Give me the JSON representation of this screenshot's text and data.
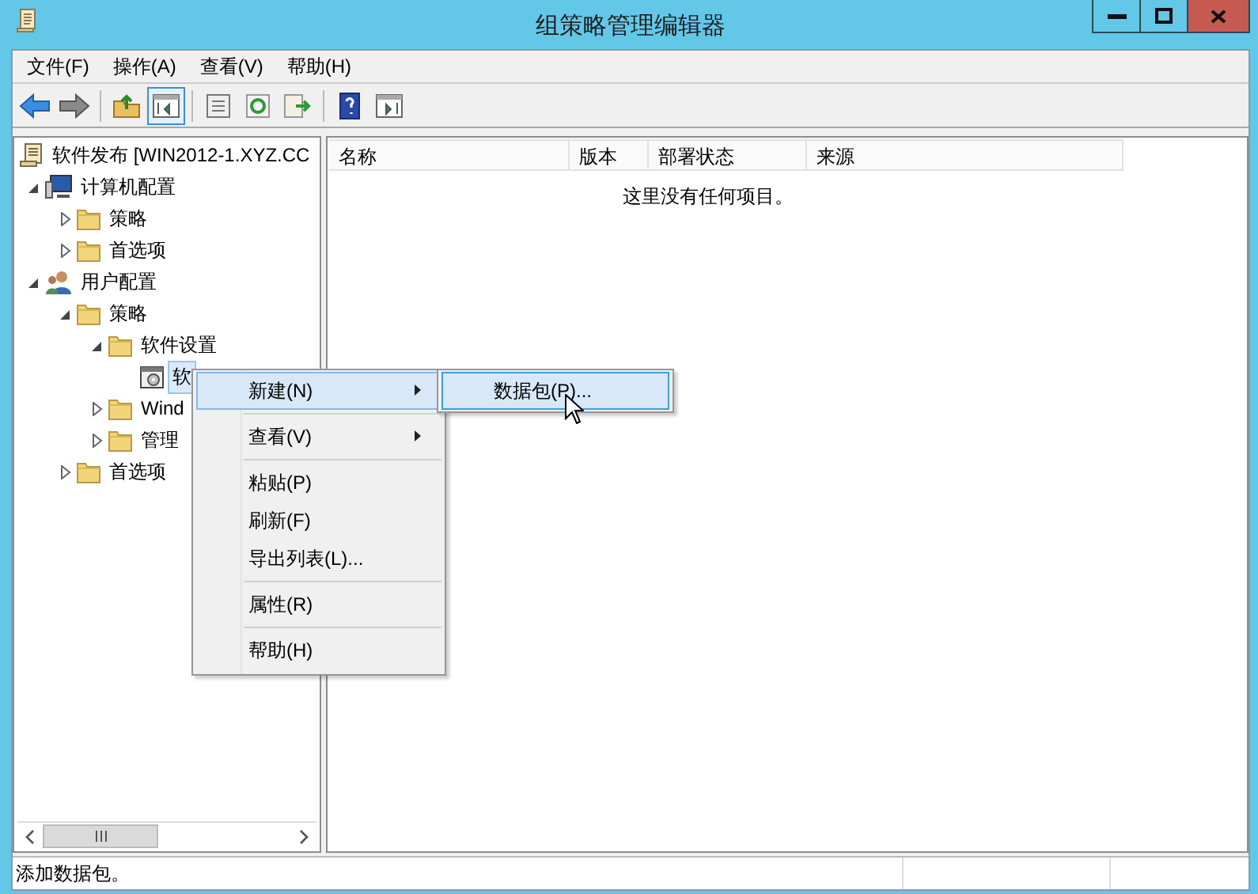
{
  "window": {
    "title": "组策略管理编辑器"
  },
  "menu_bar": [
    {
      "label": "文件(F)"
    },
    {
      "label": "操作(A)"
    },
    {
      "label": "查看(V)"
    },
    {
      "label": "帮助(H)"
    }
  ],
  "toolbar": [
    {
      "kind": "back",
      "selected": false
    },
    {
      "kind": "forward",
      "selected": false
    },
    {
      "kind": "sep"
    },
    {
      "kind": "up",
      "selected": false
    },
    {
      "kind": "console-tree",
      "selected": true
    },
    {
      "kind": "sep"
    },
    {
      "kind": "properties",
      "selected": false
    },
    {
      "kind": "refresh",
      "selected": false
    },
    {
      "kind": "export",
      "selected": false
    },
    {
      "kind": "sep"
    },
    {
      "kind": "help",
      "selected": false
    },
    {
      "kind": "action-pane",
      "selected": false
    }
  ],
  "tree": [
    {
      "label": "软件发布 [WIN2012-1.XYZ.CC",
      "kind": "gpo",
      "selected": false,
      "children": [
        {
          "label": "计算机配置",
          "kind": "computer",
          "expanded": true,
          "selected": false,
          "children": [
            {
              "label": "策略",
              "kind": "folder",
              "expanded": false,
              "selected": false
            },
            {
              "label": "首选项",
              "kind": "folder",
              "expanded": false,
              "selected": false
            }
          ]
        },
        {
          "label": "用户配置",
          "kind": "user",
          "expanded": true,
          "selected": false,
          "children": [
            {
              "label": "策略",
              "kind": "folder",
              "expanded": true,
              "selected": false,
              "children": [
                {
                  "label": "软件设置",
                  "kind": "folder",
                  "expanded": true,
                  "selected": false,
                  "children": [
                    {
                      "label": "软",
                      "kind": "package",
                      "selected": true
                    }
                  ]
                },
                {
                  "label": "Wind",
                  "kind": "folder",
                  "expanded": false,
                  "selected": false
                },
                {
                  "label": "管理",
                  "kind": "folder",
                  "expanded": false,
                  "selected": false
                }
              ]
            },
            {
              "label": "首选项",
              "kind": "folder",
              "expanded": false,
              "selected": false
            }
          ]
        }
      ]
    }
  ],
  "list": {
    "columns": [
      "名称",
      "版本",
      "部署状态",
      "来源"
    ],
    "empty_text": "这里没有任何项目。"
  },
  "context_menu": [
    {
      "kind": "item",
      "label": "新建(N)",
      "submenu": true,
      "selected": true
    },
    {
      "kind": "separator"
    },
    {
      "kind": "item",
      "label": "查看(V)",
      "submenu": true,
      "selected": false
    },
    {
      "kind": "separator"
    },
    {
      "kind": "item",
      "label": "粘贴(P)",
      "submenu": false,
      "selected": false
    },
    {
      "kind": "item",
      "label": "刷新(F)",
      "submenu": false,
      "selected": false
    },
    {
      "kind": "item",
      "label": "导出列表(L)...",
      "submenu": false,
      "selected": false
    },
    {
      "kind": "separator"
    },
    {
      "kind": "item",
      "label": "属性(R)",
      "submenu": false,
      "selected": false
    },
    {
      "kind": "separator"
    },
    {
      "kind": "item",
      "label": "帮助(H)",
      "submenu": false,
      "selected": false
    }
  ],
  "submenu": [
    {
      "label": "数据包(P)...",
      "selected": true
    }
  ],
  "status_bar": {
    "text": "添加数据包。"
  }
}
